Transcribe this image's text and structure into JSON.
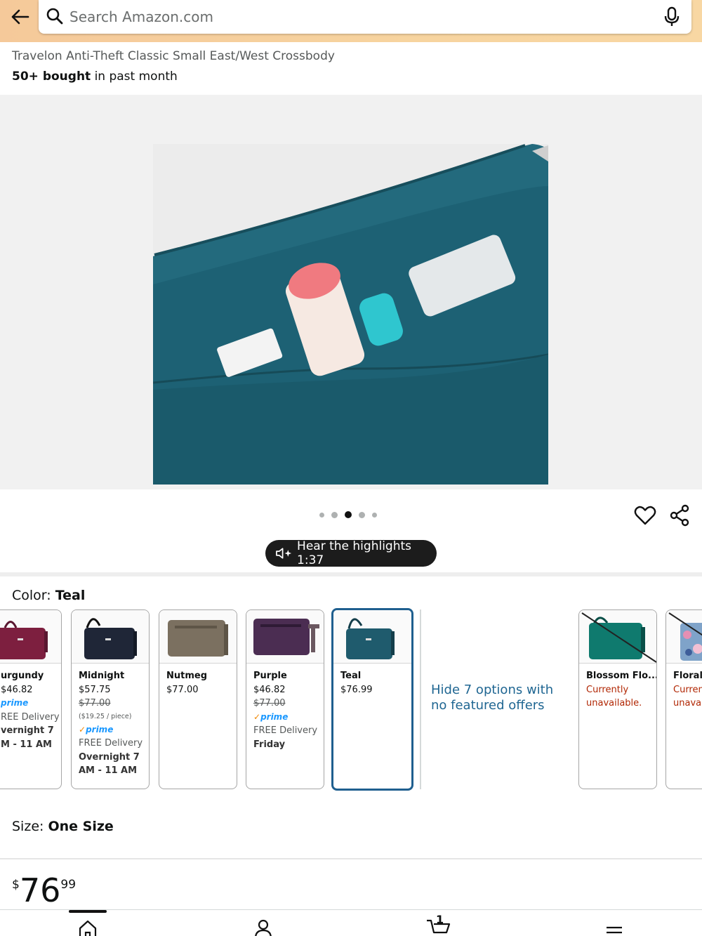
{
  "header": {
    "search_placeholder": "Search Amazon.com"
  },
  "product": {
    "title": "Travelon Anti-Theft Classic Small East/West Crossbody",
    "bought_bold": "50+ bought",
    "bought_rest": " in past month",
    "carousel": {
      "total": 5,
      "active_index": 2
    },
    "highlights_button": "Hear the highlights 1:37"
  },
  "color": {
    "label": "Color: ",
    "value": "Teal",
    "swatches": [
      {
        "name": "urgundy",
        "price": "46.82",
        "prime": "prime",
        "line1": "REE Delivery",
        "line2": "vernight 7",
        "line3": "M - 11 AM",
        "color": "#7d1f3f"
      },
      {
        "name": "Midnight",
        "price": "$57.75",
        "list_price": "$77.00",
        "unit": "($19.25 / piece)",
        "prime": "prime",
        "line1": "FREE Delivery",
        "line2": "Overnight 7",
        "line3": "AM - 11 AM",
        "color": "#1f2637"
      },
      {
        "name": "Nutmeg",
        "price": "$77.00",
        "color": "#7b7060"
      },
      {
        "name": "Purple",
        "price": "$46.82",
        "list_price": "$77.00",
        "prime": "prime",
        "line1": "FREE Delivery",
        "line2": "Friday",
        "color": "#4b2d52"
      },
      {
        "name": "Teal",
        "price": "$76.99",
        "color": "#1f5b6d"
      },
      {
        "name": "Blossom Flo...",
        "status1": "Currently",
        "status2": "unavailable.",
        "color": "#0f7a6e"
      },
      {
        "name": "Floral",
        "status1": "Curren",
        "status2": "unavai",
        "color": "#7fa3c9"
      }
    ],
    "hide_options": "Hide 7 options with no featured offers"
  },
  "size": {
    "label": "Size: ",
    "value": "One Size"
  },
  "price": {
    "symbol": "$",
    "whole": "76",
    "fraction": "99"
  },
  "bottom_nav": {
    "cart_count": "1",
    "items": [
      "home-icon",
      "account-icon",
      "cart-icon",
      "menu-icon"
    ]
  },
  "colors": {
    "header_bg": "#f7d49f",
    "link": "#1f6692",
    "selected_border": "#1f5f8f",
    "unavailable": "#b12704",
    "prime": "#1a98ff"
  }
}
